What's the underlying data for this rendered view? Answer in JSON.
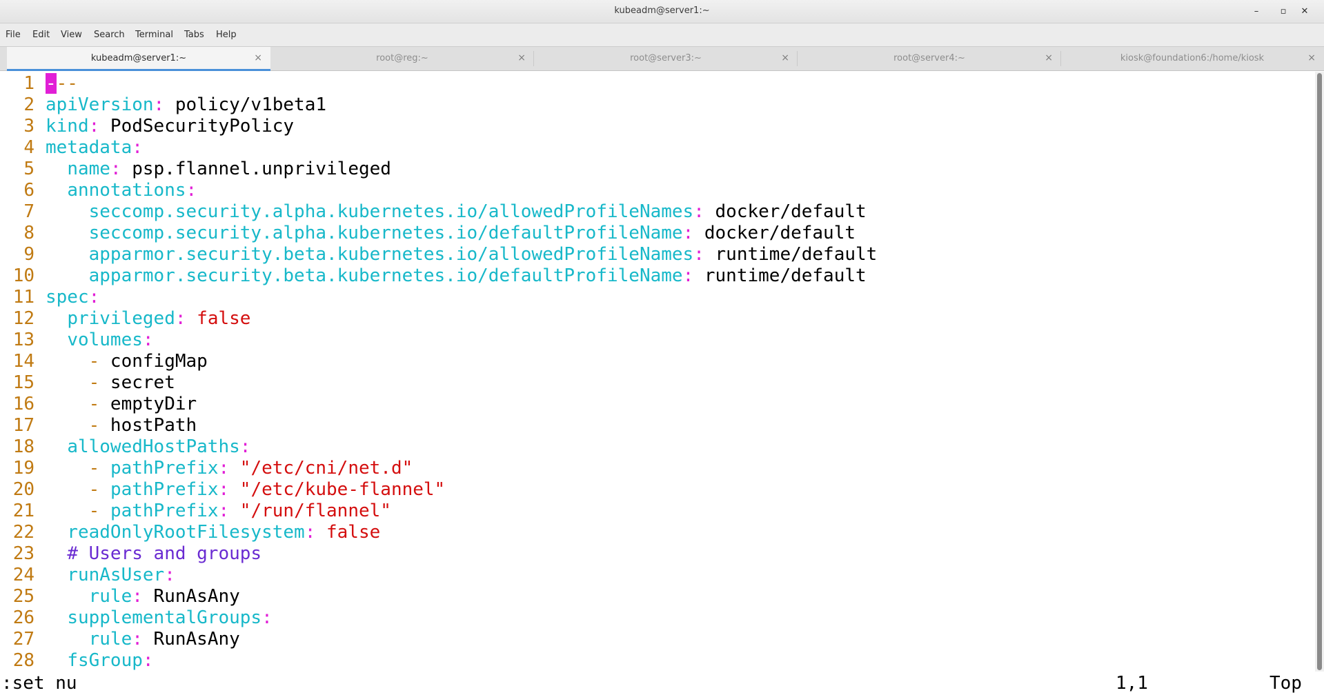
{
  "window": {
    "title": "kubeadm@server1:~",
    "minimize_glyph": "–",
    "maximize_glyph": "▫",
    "close_glyph": "✕"
  },
  "menu": [
    "File",
    "Edit",
    "View",
    "Search",
    "Terminal",
    "Tabs",
    "Help"
  ],
  "tabs": [
    {
      "label": "kubeadm@server1:~",
      "close": "×",
      "active": true
    },
    {
      "label": "root@reg:~",
      "close": "×",
      "active": false
    },
    {
      "label": "root@server3:~",
      "close": "×",
      "active": false
    },
    {
      "label": "root@server4:~",
      "close": "×",
      "active": false
    },
    {
      "label": "kiosk@foundation6:/home/kiosk",
      "close": "×",
      "active": false
    }
  ],
  "editor": {
    "lines": [
      {
        "n": "1",
        "t": [
          [
            "cursor",
            "-"
          ],
          [
            "dash",
            "--"
          ]
        ]
      },
      {
        "n": "2",
        "t": [
          [
            "key",
            "apiVersion"
          ],
          [
            "colon",
            ":"
          ],
          [
            "plain",
            " policy/v1beta1"
          ]
        ]
      },
      {
        "n": "3",
        "t": [
          [
            "key",
            "kind"
          ],
          [
            "colon",
            ":"
          ],
          [
            "plain",
            " PodSecurityPolicy"
          ]
        ]
      },
      {
        "n": "4",
        "t": [
          [
            "key",
            "metadata"
          ],
          [
            "colon",
            ":"
          ]
        ]
      },
      {
        "n": "5",
        "t": [
          [
            "plain",
            "  "
          ],
          [
            "key",
            "name"
          ],
          [
            "colon",
            ":"
          ],
          [
            "plain",
            " psp.flannel.unprivileged"
          ]
        ]
      },
      {
        "n": "6",
        "t": [
          [
            "plain",
            "  "
          ],
          [
            "key",
            "annotations"
          ],
          [
            "colon",
            ":"
          ]
        ]
      },
      {
        "n": "7",
        "t": [
          [
            "plain",
            "    "
          ],
          [
            "key",
            "seccomp.security.alpha.kubernetes.io/allowedProfileNames"
          ],
          [
            "colon",
            ":"
          ],
          [
            "plain",
            " docker/default"
          ]
        ]
      },
      {
        "n": "8",
        "t": [
          [
            "plain",
            "    "
          ],
          [
            "key",
            "seccomp.security.alpha.kubernetes.io/defaultProfileName"
          ],
          [
            "colon",
            ":"
          ],
          [
            "plain",
            " docker/default"
          ]
        ]
      },
      {
        "n": "9",
        "t": [
          [
            "plain",
            "    "
          ],
          [
            "key",
            "apparmor.security.beta.kubernetes.io/allowedProfileNames"
          ],
          [
            "colon",
            ":"
          ],
          [
            "plain",
            " runtime/default"
          ]
        ]
      },
      {
        "n": "10",
        "t": [
          [
            "plain",
            "    "
          ],
          [
            "key",
            "apparmor.security.beta.kubernetes.io/defaultProfileName"
          ],
          [
            "colon",
            ":"
          ],
          [
            "plain",
            " runtime/default"
          ]
        ]
      },
      {
        "n": "11",
        "t": [
          [
            "key",
            "spec"
          ],
          [
            "colon",
            ":"
          ]
        ]
      },
      {
        "n": "12",
        "t": [
          [
            "plain",
            "  "
          ],
          [
            "key",
            "privileged"
          ],
          [
            "colon",
            ":"
          ],
          [
            "plain",
            " "
          ],
          [
            "str",
            "false"
          ]
        ]
      },
      {
        "n": "13",
        "t": [
          [
            "plain",
            "  "
          ],
          [
            "key",
            "volumes"
          ],
          [
            "colon",
            ":"
          ]
        ]
      },
      {
        "n": "14",
        "t": [
          [
            "plain",
            "    "
          ],
          [
            "dash",
            "-"
          ],
          [
            "plain",
            " configMap"
          ]
        ]
      },
      {
        "n": "15",
        "t": [
          [
            "plain",
            "    "
          ],
          [
            "dash",
            "-"
          ],
          [
            "plain",
            " secret"
          ]
        ]
      },
      {
        "n": "16",
        "t": [
          [
            "plain",
            "    "
          ],
          [
            "dash",
            "-"
          ],
          [
            "plain",
            " emptyDir"
          ]
        ]
      },
      {
        "n": "17",
        "t": [
          [
            "plain",
            "    "
          ],
          [
            "dash",
            "-"
          ],
          [
            "plain",
            " hostPath"
          ]
        ]
      },
      {
        "n": "18",
        "t": [
          [
            "plain",
            "  "
          ],
          [
            "key",
            "allowedHostPaths"
          ],
          [
            "colon",
            ":"
          ]
        ]
      },
      {
        "n": "19",
        "t": [
          [
            "plain",
            "    "
          ],
          [
            "dash",
            "-"
          ],
          [
            "plain",
            " "
          ],
          [
            "key",
            "pathPrefix"
          ],
          [
            "colon",
            ":"
          ],
          [
            "plain",
            " "
          ],
          [
            "str",
            "\"/etc/cni/net.d\""
          ]
        ]
      },
      {
        "n": "20",
        "t": [
          [
            "plain",
            "    "
          ],
          [
            "dash",
            "-"
          ],
          [
            "plain",
            " "
          ],
          [
            "key",
            "pathPrefix"
          ],
          [
            "colon",
            ":"
          ],
          [
            "plain",
            " "
          ],
          [
            "str",
            "\"/etc/kube-flannel\""
          ]
        ]
      },
      {
        "n": "21",
        "t": [
          [
            "plain",
            "    "
          ],
          [
            "dash",
            "-"
          ],
          [
            "plain",
            " "
          ],
          [
            "key",
            "pathPrefix"
          ],
          [
            "colon",
            ":"
          ],
          [
            "plain",
            " "
          ],
          [
            "str",
            "\"/run/flannel\""
          ]
        ]
      },
      {
        "n": "22",
        "t": [
          [
            "plain",
            "  "
          ],
          [
            "key",
            "readOnlyRootFilesystem"
          ],
          [
            "colon",
            ":"
          ],
          [
            "plain",
            " "
          ],
          [
            "str",
            "false"
          ]
        ]
      },
      {
        "n": "23",
        "t": [
          [
            "plain",
            "  "
          ],
          [
            "cmt",
            "# Users and groups"
          ]
        ]
      },
      {
        "n": "24",
        "t": [
          [
            "plain",
            "  "
          ],
          [
            "key",
            "runAsUser"
          ],
          [
            "colon",
            ":"
          ]
        ]
      },
      {
        "n": "25",
        "t": [
          [
            "plain",
            "    "
          ],
          [
            "key",
            "rule"
          ],
          [
            "colon",
            ":"
          ],
          [
            "plain",
            " RunAsAny"
          ]
        ]
      },
      {
        "n": "26",
        "t": [
          [
            "plain",
            "  "
          ],
          [
            "key",
            "supplementalGroups"
          ],
          [
            "colon",
            ":"
          ]
        ]
      },
      {
        "n": "27",
        "t": [
          [
            "plain",
            "    "
          ],
          [
            "key",
            "rule"
          ],
          [
            "colon",
            ":"
          ],
          [
            "plain",
            " RunAsAny"
          ]
        ]
      },
      {
        "n": "28",
        "t": [
          [
            "plain",
            "  "
          ],
          [
            "key",
            "fsGroup"
          ],
          [
            "colon",
            ":"
          ]
        ]
      }
    ]
  },
  "status": {
    "command": ":set nu",
    "position": "1,1",
    "scroll": "Top"
  },
  "colors": {
    "key": "#17b8c9",
    "colon": "#e11fd6",
    "string": "#d40e0e",
    "line_number": "#c07a12",
    "comment": "#6a2bd2",
    "active_tab_underline": "#4a90d9"
  }
}
